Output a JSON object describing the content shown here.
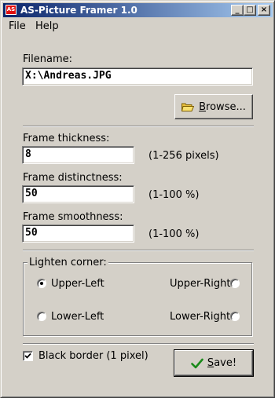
{
  "window": {
    "title": "AS-Picture Framer 1.0",
    "icon_text": "AS",
    "controls": {
      "minimize": "_",
      "maximize": "□",
      "close": "×"
    }
  },
  "menu": {
    "file": "File",
    "help": "Help"
  },
  "filename": {
    "label": "Filename:",
    "value": "X:\\Andreas.JPG",
    "browse_label": "Browse...",
    "browse_icon": "folder-icon"
  },
  "frame_thickness": {
    "label": "Frame thickness:",
    "value": "8",
    "hint": "(1-256 pixels)"
  },
  "frame_distinctness": {
    "label": "Frame distinctness:",
    "value": "50",
    "hint": "(1-100 %)"
  },
  "frame_smoothness": {
    "label": "Frame smoothness:",
    "value": "50",
    "hint": "(1-100 %)"
  },
  "lighten_corner": {
    "legend": "Lighten corner:",
    "selected": "Upper-Left",
    "options": {
      "upper_left": "Upper-Left",
      "upper_right": "Upper-Right",
      "lower_left": "Lower-Left",
      "lower_right": "Lower-Right"
    }
  },
  "black_border": {
    "label": "Black border (1 pixel)",
    "checked": true
  },
  "save": {
    "label": "Save!",
    "icon": "checkmark-icon"
  },
  "colors": {
    "titlebar_start": "#0a246a",
    "titlebar_end": "#a6caf0",
    "face": "#d4d0c8",
    "check": "#1a8a1a"
  }
}
